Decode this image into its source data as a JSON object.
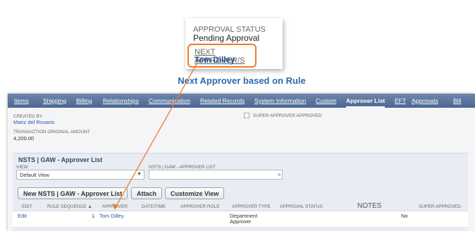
{
  "callout": {
    "status_caption": "APPROVAL STATUS",
    "status_value": "Pending Approval",
    "next_caption": "NEXT APPROVER/S",
    "next_value": "Tom Dilley",
    "highlight_color": "#f07a2a"
  },
  "headline": "Next Approver based on Rule",
  "tabs": [
    {
      "label": "Items"
    },
    {
      "label": "Shipping"
    },
    {
      "label": "Billing"
    },
    {
      "label": "Relationships"
    },
    {
      "label": "Communication"
    },
    {
      "label": "Related Records"
    },
    {
      "label": "System Information"
    },
    {
      "label": "Custom"
    },
    {
      "label": "Approver List",
      "active": true
    },
    {
      "label": "EFT"
    },
    {
      "label": "Approvals"
    },
    {
      "label": "Bill"
    }
  ],
  "record": {
    "created_by_label": "CREATED BY",
    "created_by_value": "Mariz del Rosario",
    "amount_label": "TRANSACTION ORIGINAL AMOUNT",
    "amount_value": "4,200.00",
    "super_approved_label": "SUPER APPROVER APPROVED"
  },
  "approver_list": {
    "title": "NSTS | GAW - Approver List",
    "view_label": "VIEW",
    "view_value": "Default View",
    "filter_label": "NSTS | GAW - APPROVER LIST",
    "buttons": {
      "new": "New NSTS | GAW - Approver List",
      "attach": "Attach",
      "customize": "Customize View"
    },
    "columns": [
      "EDIT",
      "RULE SEQUENCE ▲",
      "APPROVER",
      "DATE/TIME",
      "APPROVER ROLE",
      "APPROVER TYPE",
      "APPROVAL STATUS",
      "NOTES",
      "SUPER APPROVED"
    ],
    "rows": [
      {
        "edit": "Edit",
        "sequence": "1",
        "approver": "Tom Dilley",
        "type_line1": "Department",
        "type_line2": "Approver",
        "super_approved": "No"
      }
    ]
  },
  "colors": {
    "tabbar": "#5a749c",
    "link": "#2a5aa0",
    "annotation_arrow": "#f07a2a"
  }
}
